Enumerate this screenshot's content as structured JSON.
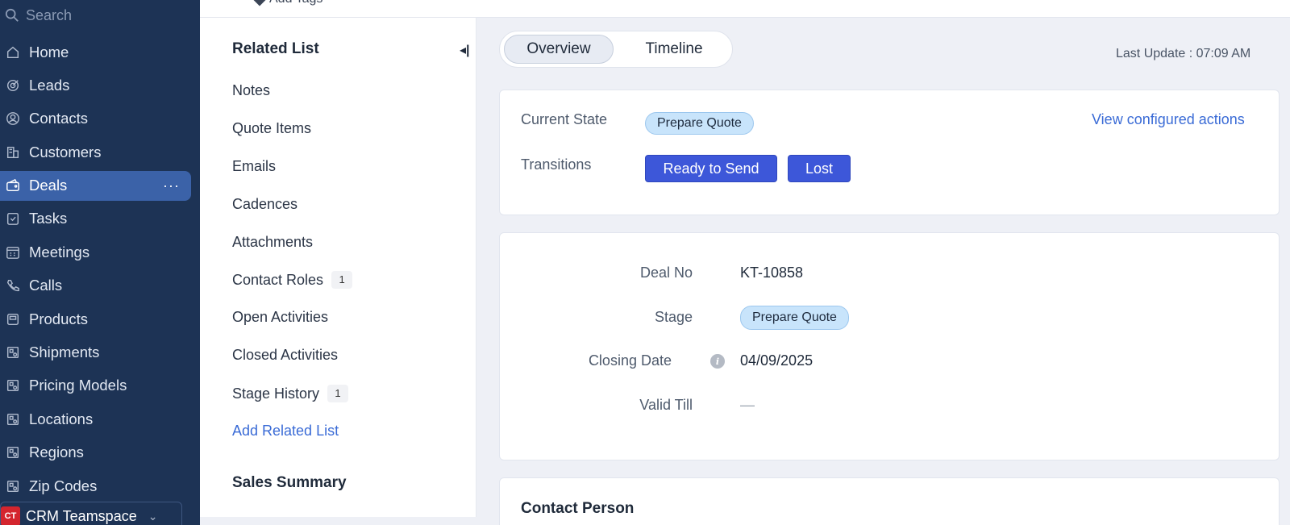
{
  "sidebar": {
    "search_placeholder": "Search",
    "items": [
      {
        "label": "Home",
        "icon": "home-icon"
      },
      {
        "label": "Leads",
        "icon": "leads-icon"
      },
      {
        "label": "Contacts",
        "icon": "contacts-icon"
      },
      {
        "label": "Customers",
        "icon": "customers-icon"
      },
      {
        "label": "Deals",
        "icon": "deals-icon",
        "active": true,
        "more": "···"
      },
      {
        "label": "Tasks",
        "icon": "tasks-icon"
      },
      {
        "label": "Meetings",
        "icon": "meetings-icon"
      },
      {
        "label": "Calls",
        "icon": "calls-icon"
      },
      {
        "label": "Products",
        "icon": "products-icon"
      },
      {
        "label": "Shipments",
        "icon": "module-icon"
      },
      {
        "label": "Pricing Models",
        "icon": "module-icon"
      },
      {
        "label": "Locations",
        "icon": "module-icon"
      },
      {
        "label": "Regions",
        "icon": "module-icon"
      },
      {
        "label": "Zip Codes",
        "icon": "module-icon"
      }
    ],
    "teamspace": {
      "badge": "CT",
      "label": "CRM Teamspace"
    }
  },
  "header": {
    "add_tags": "Add Tags"
  },
  "related_list": {
    "title": "Related List",
    "items": [
      {
        "label": "Notes"
      },
      {
        "label": "Quote Items"
      },
      {
        "label": "Emails"
      },
      {
        "label": "Cadences"
      },
      {
        "label": "Attachments"
      },
      {
        "label": "Contact Roles",
        "count": "1"
      },
      {
        "label": "Open Activities"
      },
      {
        "label": "Closed Activities"
      },
      {
        "label": "Stage History",
        "count": "1"
      }
    ],
    "add_link": "Add Related List",
    "sales_summary": "Sales Summary"
  },
  "main": {
    "tabs": [
      "Overview",
      "Timeline"
    ],
    "last_update": "Last Update : 07:09 AM",
    "state_card": {
      "current_state_label": "Current State",
      "current_state_value": "Prepare Quote",
      "transitions_label": "Transitions",
      "transitions": [
        "Ready to Send",
        "Lost"
      ],
      "view_actions": "View configured actions"
    },
    "fields": {
      "deal_no_label": "Deal No",
      "deal_no_value": "KT-10858",
      "stage_label": "Stage",
      "stage_value": "Prepare Quote",
      "closing_date_label": "Closing Date",
      "closing_date_value": "04/09/2025",
      "valid_till_label": "Valid Till",
      "valid_till_value": "—"
    },
    "contact_person_title": "Contact Person"
  },
  "colors": {
    "sidebar_bg": "#1d3355",
    "sidebar_active": "#3b62a8",
    "primary_button": "#3d57d9",
    "pill_bg": "#c8e4fb",
    "link": "#3a6bd6"
  }
}
